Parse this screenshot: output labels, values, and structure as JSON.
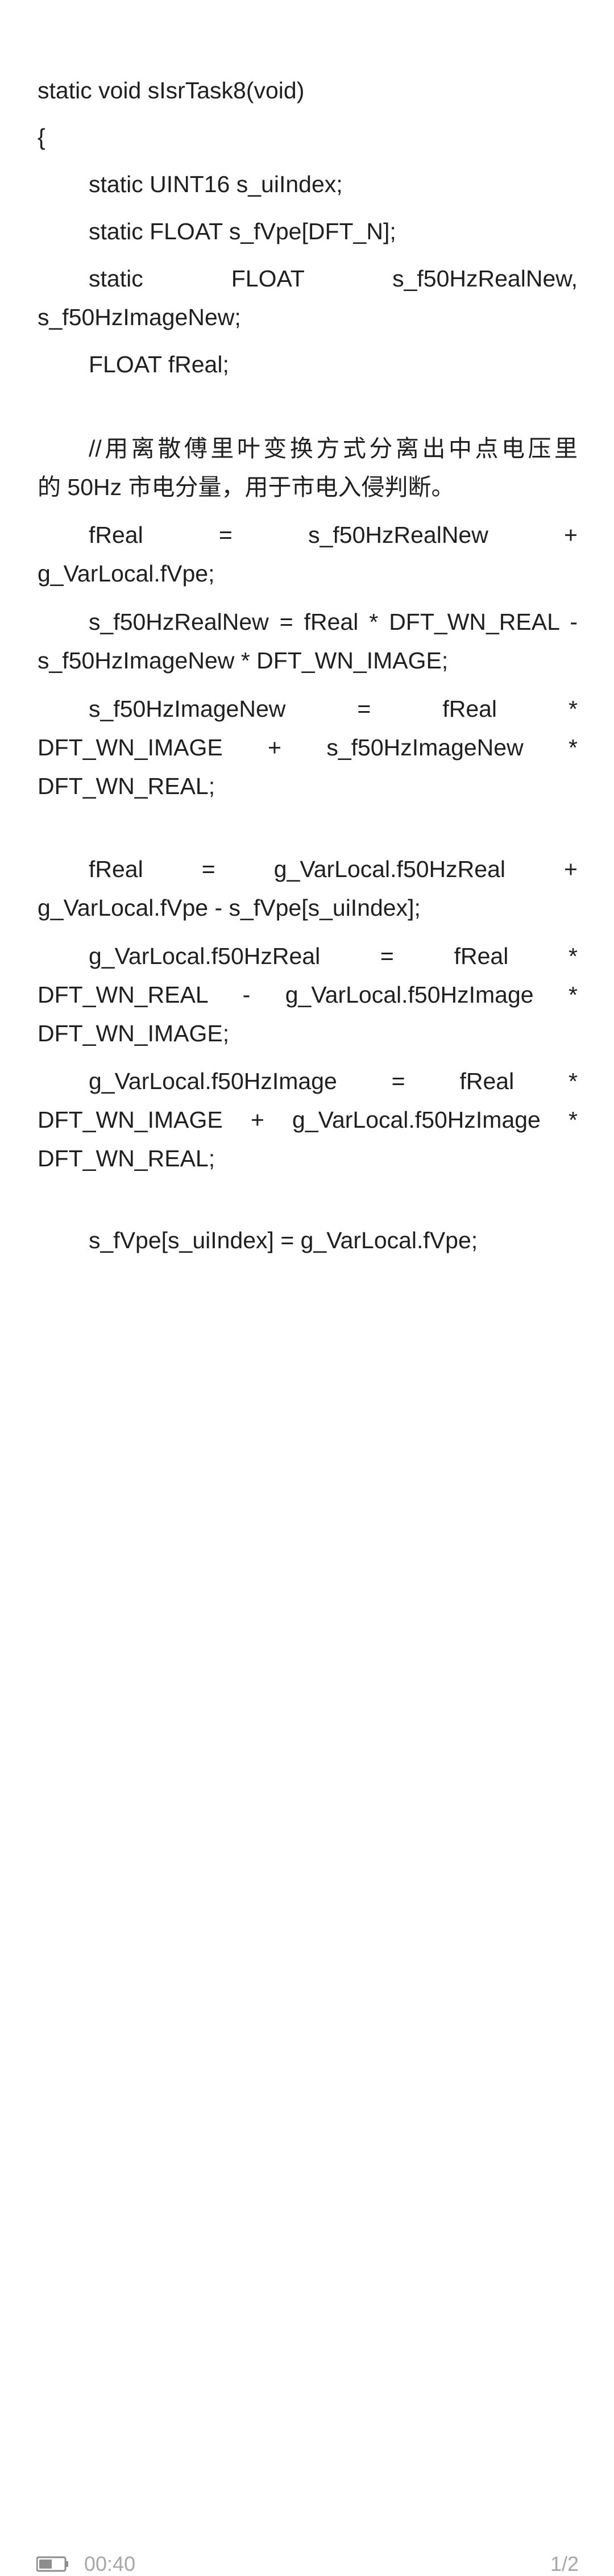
{
  "document": {
    "lines": [
      "static void sIsrTask8(void)",
      "{",
      "static UINT16 s_uiIndex;",
      "static FLOAT s_fVpe[DFT_N];",
      "static FLOAT s_f50HzRealNew,",
      "s_f50HzImageNew;",
      "FLOAT fReal;",
      "//用离散傅里叶变换方式分离出中点电压里",
      "的 50Hz 市电分量，用于市电入侵判断。",
      "fReal = s_f50HzRealNew +",
      "g_VarLocal.fVpe;",
      "s_f50HzRealNew = fReal * DFT_WN_REAL -",
      "s_f50HzImageNew * DFT_WN_IMAGE;",
      "s_f50HzImageNew = fReal *",
      "DFT_WN_IMAGE + s_f50HzImageNew *",
      "DFT_WN_REAL;",
      "fReal = g_VarLocal.f50HzReal +",
      "g_VarLocal.fVpe - s_fVpe[s_uiIndex];",
      "g_VarLocal.f50HzReal = fReal *",
      "DFT_WN_REAL - g_VarLocal.f50HzImage *",
      "DFT_WN_IMAGE;",
      "g_VarLocal.f50HzImage = fReal *",
      "DFT_WN_IMAGE + g_VarLocal.f50HzImage *",
      "DFT_WN_REAL;",
      "s_fVpe[s_uiIndex] = g_VarLocal.fVpe;"
    ]
  },
  "status_bar": {
    "battery_icon": "battery-icon",
    "time": "00:40",
    "page_indicator": "1/2"
  }
}
